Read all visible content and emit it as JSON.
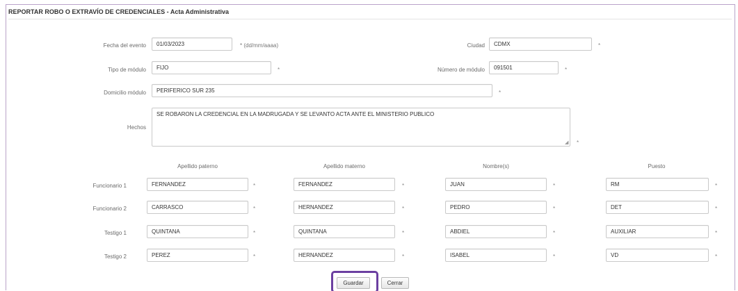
{
  "header": {
    "title": "REPORTAR ROBO O EXTRAVÍO DE CREDENCIALES - Acta Administrativa"
  },
  "form": {
    "fecha": {
      "label": "Fecha del evento",
      "value": "01/03/2023",
      "hint": "* (dd/mm/aaaa)"
    },
    "ciudad": {
      "label": "Ciudad",
      "value": "CDMX"
    },
    "tipo": {
      "label": "Tipo de módulo",
      "value": "FIJO"
    },
    "numero": {
      "label": "Número de módulo",
      "value": "091501"
    },
    "domicilio": {
      "label": "Domicilio módulo",
      "value": "PERIFERICO SUR 235"
    },
    "hechos": {
      "label": "Hechos",
      "value": "SE ROBARON LA CREDENCIAL EN LA MADRUGADA Y SE LEVANTO ACTA ANTE EL MINISTERIO PUBLICO"
    },
    "required_mark": "*"
  },
  "table": {
    "columns": [
      "Apellido paterno",
      "Apellido materno",
      "Nombre(s)",
      "Puesto"
    ],
    "rows": [
      {
        "label": "Funcionario 1",
        "values": [
          "FERNANDEZ",
          "FERNANDEZ",
          "JUAN",
          "RM"
        ]
      },
      {
        "label": "Funcionario 2",
        "values": [
          "CARRASCO",
          "HERNANDEZ",
          "PEDRO",
          "DET"
        ]
      },
      {
        "label": "Testigo 1",
        "values": [
          "QUINTANA",
          "QUINTANA",
          "ABDIEL",
          "AUXILIAR"
        ]
      },
      {
        "label": "Testigo 2",
        "values": [
          "PEREZ",
          "HERNANDEZ",
          "ISABEL",
          "VD"
        ]
      }
    ]
  },
  "buttons": {
    "save_label": "Guardar",
    "close_label": "Cerrar"
  },
  "colors": {
    "highlight": "#6b3fa0",
    "frame": "#b9a3c9"
  }
}
